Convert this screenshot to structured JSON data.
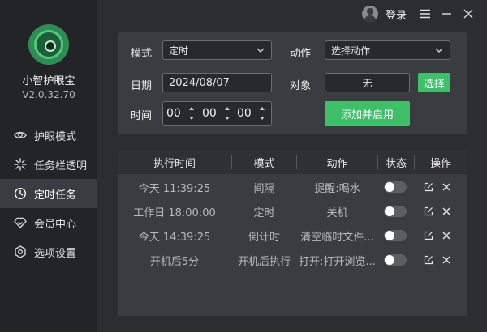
{
  "app": {
    "name": "小智护眼宝",
    "version": "V2.0.32.70"
  },
  "header": {
    "login_label": "登录"
  },
  "sidebar": {
    "items": [
      {
        "label": "护眼模式",
        "icon": "eye-icon"
      },
      {
        "label": "任务栏透明",
        "icon": "sparkle-icon"
      },
      {
        "label": "定时任务",
        "icon": "clock-icon",
        "active": true
      },
      {
        "label": "会员中心",
        "icon": "diamond-icon"
      },
      {
        "label": "选项设置",
        "icon": "gear-icon"
      }
    ]
  },
  "form": {
    "mode_label": "模式",
    "mode_value": "定时",
    "action_label": "动作",
    "action_value": "选择动作",
    "date_label": "日期",
    "date_value": "2024/08/07",
    "target_label": "对象",
    "target_value": "无",
    "select_button": "选择",
    "time_label": "时间",
    "time_hour": "00",
    "time_minute": "00",
    "time_second": "00",
    "add_button": "添加并启用"
  },
  "table": {
    "headers": [
      "执行时间",
      "模式",
      "动作",
      "状态",
      "操作"
    ],
    "rows": [
      {
        "time": "今天 11:39:25",
        "mode": "间隔",
        "action": "提醒:喝水",
        "enabled": false
      },
      {
        "time": "工作日 18:00:00",
        "mode": "定时",
        "action": "关机",
        "enabled": false
      },
      {
        "time": "今天 14:39:25",
        "mode": "倒计时",
        "action": "清空临时文件...",
        "enabled": false
      },
      {
        "time": "开机后5分",
        "mode": "开机后执行",
        "action": "打开:打开浏览...",
        "enabled": false
      }
    ]
  },
  "colors": {
    "accent": "#3fbf6a",
    "background": "#2b2d31",
    "sidebar": "#232428",
    "panel": "#3a3c40"
  }
}
